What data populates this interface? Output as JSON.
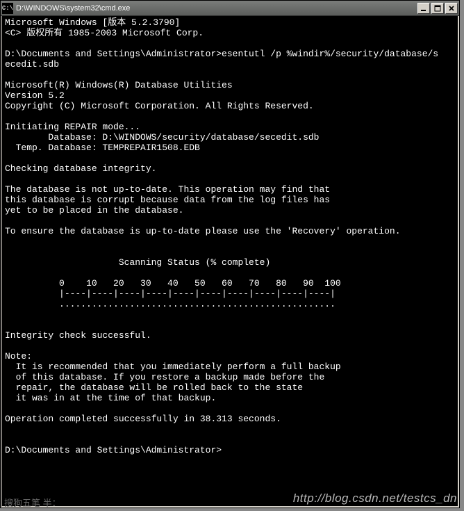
{
  "titlebar": {
    "icon_label": "cmd",
    "title": "D:\\WINDOWS\\system32\\cmd.exe"
  },
  "console": {
    "lines": [
      "Microsoft Windows [版本 5.2.3790]",
      "<C> 版权所有 1985-2003 Microsoft Corp.",
      "",
      "D:\\Documents and Settings\\Administrator>esentutl /p %windir%/security/database/s",
      "ecedit.sdb",
      "",
      "Microsoft(R) Windows(R) Database Utilities",
      "Version 5.2",
      "Copyright (C) Microsoft Corporation. All Rights Reserved.",
      "",
      "Initiating REPAIR mode...",
      "        Database: D:\\WINDOWS/security/database/secedit.sdb",
      "  Temp. Database: TEMPREPAIR1508.EDB",
      "",
      "Checking database integrity.",
      "",
      "The database is not up-to-date. This operation may find that",
      "this database is corrupt because data from the log files has",
      "yet to be placed in the database.",
      "",
      "To ensure the database is up-to-date please use the 'Recovery' operation.",
      "",
      "",
      "                     Scanning Status (% complete)",
      "",
      "          0    10   20   30   40   50   60   70   80   90  100",
      "          |----|----|----|----|----|----|----|----|----|----|",
      "          ...................................................",
      "",
      "",
      "Integrity check successful.",
      "",
      "Note:",
      "  It is recommended that you immediately perform a full backup",
      "  of this database. If you restore a backup made before the",
      "  repair, the database will be rolled back to the state",
      "  it was in at the time of that backup.",
      "",
      "Operation completed successfully in 38.313 seconds.",
      "",
      "",
      "D:\\Documents and Settings\\Administrator>"
    ]
  },
  "ime": {
    "text": "搜狗五笔 半："
  },
  "watermark": {
    "text": "http://blog.csdn.net/testcs_dn"
  }
}
